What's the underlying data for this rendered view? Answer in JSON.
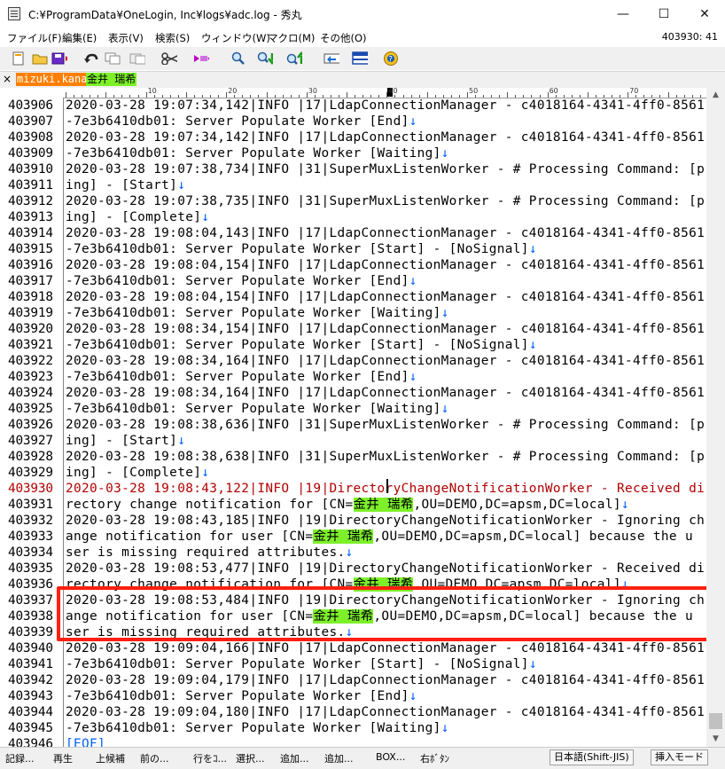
{
  "window": {
    "title": "C:¥ProgramData¥OneLogin, Inc¥logs¥adc.log - 秀丸",
    "minimize": "—",
    "maximize": "☐",
    "close": "✕"
  },
  "menu": {
    "items": [
      "ファイル(F)",
      "編集(E)",
      "表示(V)",
      "検索(S)",
      "ウィンドウ(W)",
      "マクロ(M)",
      "その他(O)"
    ],
    "position": "403930: 41"
  },
  "toolbar": {
    "icons": [
      "new-file-icon",
      "open-folder-icon",
      "save-icon",
      "undo-icon",
      "copy-icon",
      "cut-icon",
      "paste-icon",
      "find-icon",
      "find-down-icon",
      "find-up-icon",
      "tag-jump-icon",
      "window-split-icon",
      "help-icon"
    ]
  },
  "tabbar": {
    "close": "×",
    "tag1": "mizuki.kanai",
    "tag2": "金井 瑞希"
  },
  "ruler": {
    "labels": [
      "10",
      "20",
      "30",
      "40",
      "50",
      "60",
      "70"
    ]
  },
  "editor": {
    "lines": [
      {
        "num": "403906",
        "segments": [
          {
            "t": "2020-03-28 19:07:34,142|INFO |17|LdapConnectionManager - c4018164-4341-4ff0-8561"
          }
        ]
      },
      {
        "num": "403907",
        "segments": [
          {
            "t": "-7e3b6410db01: Server Populate Worker [End]"
          },
          {
            "t": "↓",
            "c": "nl"
          }
        ]
      },
      {
        "num": "403908",
        "segments": [
          {
            "t": "2020-03-28 19:07:34,142|INFO |17|LdapConnectionManager - c4018164-4341-4ff0-8561"
          }
        ]
      },
      {
        "num": "403909",
        "segments": [
          {
            "t": "-7e3b6410db01: Server Populate Worker [Waiting]"
          },
          {
            "t": "↓",
            "c": "nl"
          }
        ]
      },
      {
        "num": "403910",
        "segments": [
          {
            "t": "2020-03-28 19:07:38,734|INFO |31|SuperMuxListenWorker - # Processing Command: [p"
          }
        ]
      },
      {
        "num": "403911",
        "segments": [
          {
            "t": "ing] - [Start]"
          },
          {
            "t": "↓",
            "c": "nl"
          }
        ]
      },
      {
        "num": "403912",
        "segments": [
          {
            "t": "2020-03-28 19:07:38,735|INFO |31|SuperMuxListenWorker - # Processing Command: [p"
          }
        ]
      },
      {
        "num": "403913",
        "segments": [
          {
            "t": "ing] - [Complete]"
          },
          {
            "t": "↓",
            "c": "nl"
          }
        ]
      },
      {
        "num": "403914",
        "segments": [
          {
            "t": "2020-03-28 19:08:04,143|INFO |17|LdapConnectionManager - c4018164-4341-4ff0-8561"
          }
        ]
      },
      {
        "num": "403915",
        "segments": [
          {
            "t": "-7e3b6410db01: Server Populate Worker [Start] - [NoSignal]"
          },
          {
            "t": "↓",
            "c": "nl"
          }
        ]
      },
      {
        "num": "403916",
        "segments": [
          {
            "t": "2020-03-28 19:08:04,154|INFO |17|LdapConnectionManager - c4018164-4341-4ff0-8561"
          }
        ]
      },
      {
        "num": "403917",
        "segments": [
          {
            "t": "-7e3b6410db01: Server Populate Worker [End]"
          },
          {
            "t": "↓",
            "c": "nl"
          }
        ]
      },
      {
        "num": "403918",
        "segments": [
          {
            "t": "2020-03-28 19:08:04,154|INFO |17|LdapConnectionManager - c4018164-4341-4ff0-8561"
          }
        ]
      },
      {
        "num": "403919",
        "segments": [
          {
            "t": "-7e3b6410db01: Server Populate Worker [Waiting]"
          },
          {
            "t": "↓",
            "c": "nl"
          }
        ]
      },
      {
        "num": "403920",
        "segments": [
          {
            "t": "2020-03-28 19:08:34,154|INFO |17|LdapConnectionManager - c4018164-4341-4ff0-8561"
          }
        ]
      },
      {
        "num": "403921",
        "segments": [
          {
            "t": "-7e3b6410db01: Server Populate Worker [Start] - [NoSignal]"
          },
          {
            "t": "↓",
            "c": "nl"
          }
        ]
      },
      {
        "num": "403922",
        "segments": [
          {
            "t": "2020-03-28 19:08:34,164|INFO |17|LdapConnectionManager - c4018164-4341-4ff0-8561"
          }
        ]
      },
      {
        "num": "403923",
        "segments": [
          {
            "t": "-7e3b6410db01: Server Populate Worker [End]"
          },
          {
            "t": "↓",
            "c": "nl"
          }
        ]
      },
      {
        "num": "403924",
        "segments": [
          {
            "t": "2020-03-28 19:08:34,164|INFO |17|LdapConnectionManager - c4018164-4341-4ff0-8561"
          }
        ]
      },
      {
        "num": "403925",
        "segments": [
          {
            "t": "-7e3b6410db01: Server Populate Worker [Waiting]"
          },
          {
            "t": "↓",
            "c": "nl"
          }
        ]
      },
      {
        "num": "403926",
        "segments": [
          {
            "t": "2020-03-28 19:08:38,636|INFO |31|SuperMuxListenWorker - # Processing Command: [p"
          }
        ]
      },
      {
        "num": "403927",
        "segments": [
          {
            "t": "ing] - [Start]"
          },
          {
            "t": "↓",
            "c": "nl"
          }
        ]
      },
      {
        "num": "403928",
        "segments": [
          {
            "t": "2020-03-28 19:08:38,638|INFO |31|SuperMuxListenWorker - # Processing Command: [p"
          }
        ]
      },
      {
        "num": "403929",
        "segments": [
          {
            "t": "ing] - [Complete]"
          },
          {
            "t": "↓",
            "c": "nl"
          }
        ]
      },
      {
        "num": "403930",
        "current": true,
        "segments": [
          {
            "t": "2020-03-28 19:08:43,122|INFO |19|DirectoryChangeNotificationWorker - Received di"
          }
        ]
      },
      {
        "num": "403931",
        "segments": [
          {
            "t": "rectory change notification for [CN="
          },
          {
            "t": "金井 瑞希",
            "c": "hl"
          },
          {
            "t": ",OU=DEMO,DC=apsm,DC=local]"
          },
          {
            "t": "↓",
            "c": "nl"
          }
        ]
      },
      {
        "num": "403932",
        "segments": [
          {
            "t": "2020-03-28 19:08:43,185|INFO |19|DirectoryChangeNotificationWorker - Ignoring ch"
          }
        ]
      },
      {
        "num": "403933",
        "segments": [
          {
            "t": "ange notification for user [CN="
          },
          {
            "t": "金井 瑞希",
            "c": "hl"
          },
          {
            "t": ",OU=DEMO,DC=apsm,DC=local] because the u"
          }
        ]
      },
      {
        "num": "403934",
        "segments": [
          {
            "t": "ser is missing required attributes."
          },
          {
            "t": "↓",
            "c": "nl"
          }
        ]
      },
      {
        "num": "403935",
        "segments": [
          {
            "t": "2020-03-28 19:08:53,477|INFO |19|DirectoryChangeNotificationWorker - Received di"
          }
        ]
      },
      {
        "num": "403936",
        "segments": [
          {
            "t": "rectory change notification for [CN="
          },
          {
            "t": "金井 瑞希",
            "c": "hl"
          },
          {
            "t": ",OU=DEMO,DC=apsm,DC=local]"
          },
          {
            "t": "↓",
            "c": "nl"
          }
        ]
      },
      {
        "num": "403937",
        "segments": [
          {
            "t": "2020-03-28 19:08:53,484|INFO |19|DirectoryChangeNotificationWorker - Ignoring ch"
          }
        ]
      },
      {
        "num": "403938",
        "segments": [
          {
            "t": "ange notification for user [CN="
          },
          {
            "t": "金井 瑞希",
            "c": "hl"
          },
          {
            "t": ",OU=DEMO,DC=apsm,DC=local] because the u"
          }
        ]
      },
      {
        "num": "403939",
        "segments": [
          {
            "t": "ser is missing required attributes."
          },
          {
            "t": "↓",
            "c": "nl"
          }
        ]
      },
      {
        "num": "403940",
        "segments": [
          {
            "t": "2020-03-28 19:09:04,166|INFO |17|LdapConnectionManager - c4018164-4341-4ff0-8561"
          }
        ]
      },
      {
        "num": "403941",
        "segments": [
          {
            "t": "-7e3b6410db01: Server Populate Worker [Start] - [NoSignal]"
          },
          {
            "t": "↓",
            "c": "nl"
          }
        ]
      },
      {
        "num": "403942",
        "segments": [
          {
            "t": "2020-03-28 19:09:04,179|INFO |17|LdapConnectionManager - c4018164-4341-4ff0-8561"
          }
        ]
      },
      {
        "num": "403943",
        "segments": [
          {
            "t": "-7e3b6410db01: Server Populate Worker [End]"
          },
          {
            "t": "↓",
            "c": "nl"
          }
        ]
      },
      {
        "num": "403944",
        "segments": [
          {
            "t": "2020-03-28 19:09:04,180|INFO |17|LdapConnectionManager - c4018164-4341-4ff0-8561"
          }
        ]
      },
      {
        "num": "403945",
        "segments": [
          {
            "t": "-7e3b6410db01: Server Populate Worker [Waiting]"
          },
          {
            "t": "↓",
            "c": "nl"
          }
        ]
      },
      {
        "num": "403946",
        "segments": [
          {
            "t": "[EOF]",
            "c": "eof"
          }
        ]
      }
    ]
  },
  "statusbar": {
    "items": [
      "記録...",
      "再生",
      "上候補",
      "前の...",
      "行をｺ...",
      "選択...",
      "追加...",
      "追加...",
      "BOX...",
      "右ﾎﾞﾀﾝ"
    ],
    "encoding": "日本語(Shift-JIS)",
    "mode": "挿入モード"
  },
  "colors": {
    "highlight": "#7df02a",
    "annotation_box": "#ff1f0f",
    "current_line": "#b00000",
    "newline_mark": "#0060ff"
  }
}
